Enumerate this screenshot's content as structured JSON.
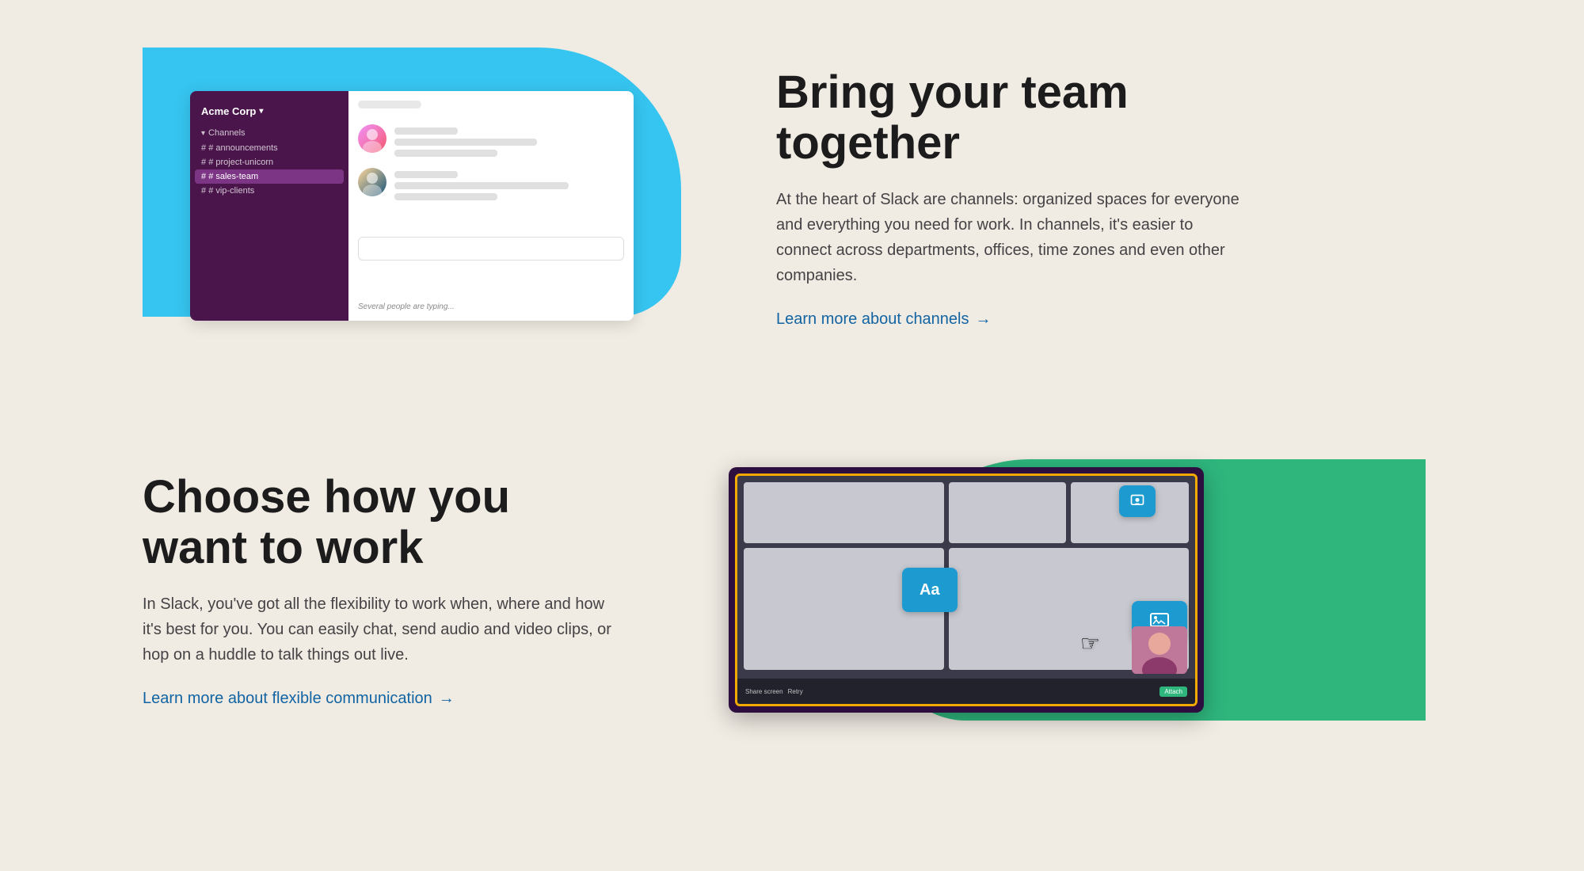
{
  "section1": {
    "slack_ui": {
      "workspace": "Acme Corp",
      "channels_label": "Channels",
      "channels": [
        {
          "name": "announcements",
          "active": false
        },
        {
          "name": "project-unicorn",
          "active": false
        },
        {
          "name": "sales-team",
          "active": true
        },
        {
          "name": "vip-clients",
          "active": false
        }
      ],
      "typing_text": "Several people are typing..."
    },
    "title": "Bring your team together",
    "body": "At the heart of Slack are channels: organized spaces for everyone and everything you need for work. In channels, it's easier to connect across departments, offices, time zones and even other companies.",
    "learn_link": "Learn more about channels",
    "learn_arrow": "→"
  },
  "section2": {
    "title": "Choose how you want to work",
    "body": "In Slack, you've got all the flexibility to work when, where and how it's best for you. You can easily chat, send audio and video clips, or hop on a huddle to talk things out live.",
    "learn_link": "Learn more about flexible communication",
    "learn_arrow": "→",
    "screen_ui": {
      "share_screen_label": "Share screen",
      "retry_label": "Retry",
      "attach_label": "Attach",
      "aa_label": "Aa"
    }
  },
  "colors": {
    "cyan": "#36c5f0",
    "green": "#2eb67d",
    "purple_dark": "#4a154b",
    "blue_link": "#1264a3",
    "text_dark": "#1d1c1d",
    "text_body": "#454245"
  }
}
